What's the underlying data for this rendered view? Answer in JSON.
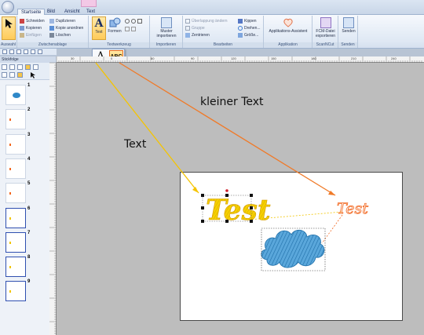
{
  "tabs": [
    {
      "label": "Startseite",
      "active": true
    },
    {
      "label": "Bild",
      "active": false
    },
    {
      "label": "Ansicht",
      "active": false
    },
    {
      "label": "Text",
      "active": false
    }
  ],
  "ribbon": {
    "auswahl": {
      "label": "Auswahl"
    },
    "zwischenablage": {
      "label": "Zwischenablage",
      "ausschneiden": "Schneiden",
      "kopieren": "Kopieren",
      "einfuegen": "Einfügen",
      "duplizieren": "Duplizieren",
      "kopie_anordnen": "Kopie anordnen",
      "loeschen": "Löschen"
    },
    "text": {
      "label": "Text"
    },
    "formen": {
      "label": "Formen"
    },
    "textwerkzeug": {
      "label": "Textwerkzeug"
    },
    "muster": {
      "label": "Muster importieren",
      "group": "Importieren"
    },
    "bearbeiten": {
      "label": "Bearbeiten",
      "ueberlappung": "Überlappung ändern",
      "gruppe": "Gruppe",
      "zentrieren": "Zentrieren",
      "kippen": "Kippen",
      "drehen": "Drehen...",
      "groesse": "Größe..."
    },
    "applikation": {
      "button": "Applikations-Assistent",
      "label": "Applikation"
    },
    "scanncut": {
      "button": "FCM-Datei exportieren",
      "label": "ScanNCut"
    },
    "senden": {
      "button": "Senden",
      "label": "Senden"
    }
  },
  "popup": {
    "icon1": "A",
    "icon2": "ABC"
  },
  "leftpanel": {
    "title": "Stickfolge",
    "items": [
      "1",
      "2",
      "3",
      "4",
      "5",
      "6",
      "7",
      "8",
      "9"
    ]
  },
  "ruler": {
    "h_labels": [
      "30",
      "0",
      "60",
      "90",
      "120",
      "150",
      "180",
      "210",
      "240"
    ]
  },
  "annotations": {
    "text_label": "Text",
    "kleiner_text_label": "kleiner Text",
    "canvas_text_big": "Test",
    "canvas_text_small": "Test"
  },
  "colors": {
    "arrow_yellow": "#f5c400",
    "arrow_orange": "#f07a28",
    "stitch_yellow": "#f2c500",
    "stitch_orange": "#f2661e",
    "stitch_blue": "#2f88c8"
  }
}
